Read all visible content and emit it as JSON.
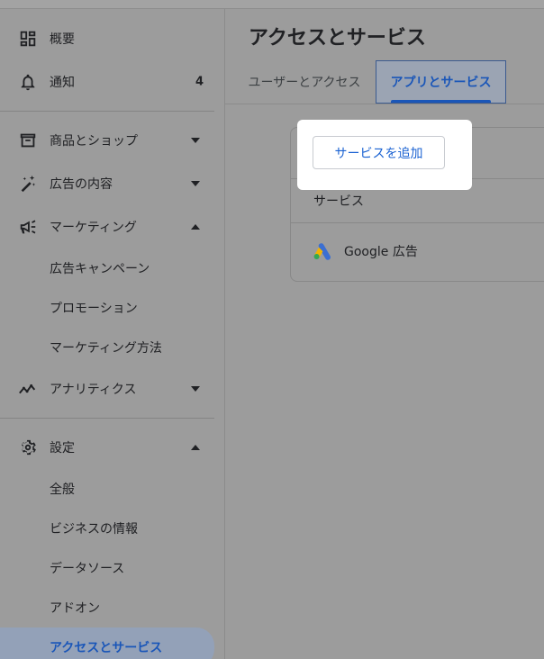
{
  "sidebar": {
    "items": [
      {
        "label": "概要",
        "icon": "dashboard-icon"
      },
      {
        "label": "通知",
        "icon": "bell-icon",
        "badge": "4"
      },
      {
        "label": "商品とショップ",
        "icon": "archive-icon"
      },
      {
        "label": "広告の内容",
        "icon": "magic-wand-icon"
      },
      {
        "label": "マーケティング",
        "icon": "megaphone-icon"
      },
      {
        "label": "広告キャンペーン"
      },
      {
        "label": "プロモーション"
      },
      {
        "label": "マーケティング方法"
      },
      {
        "label": "アナリティクス",
        "icon": "trending-icon"
      },
      {
        "label": "設定",
        "icon": "gear-icon"
      },
      {
        "label": "全般"
      },
      {
        "label": "ビジネスの情報"
      },
      {
        "label": "データソース"
      },
      {
        "label": "アドオン"
      },
      {
        "label": "アクセスとサービス"
      }
    ]
  },
  "main": {
    "title": "アクセスとサービス",
    "tabs": [
      {
        "label": "ユーザーとアクセス"
      },
      {
        "label": "アプリとサービス"
      }
    ],
    "add_service_label": "サービスを追加",
    "column_header": "サービス",
    "services": [
      {
        "name": "Google 広告",
        "icon": "google-ads-logo"
      }
    ]
  },
  "colors": {
    "accent": "#1a56b8",
    "button_text": "#1a62d2",
    "overlay": "#9c9c9c"
  }
}
